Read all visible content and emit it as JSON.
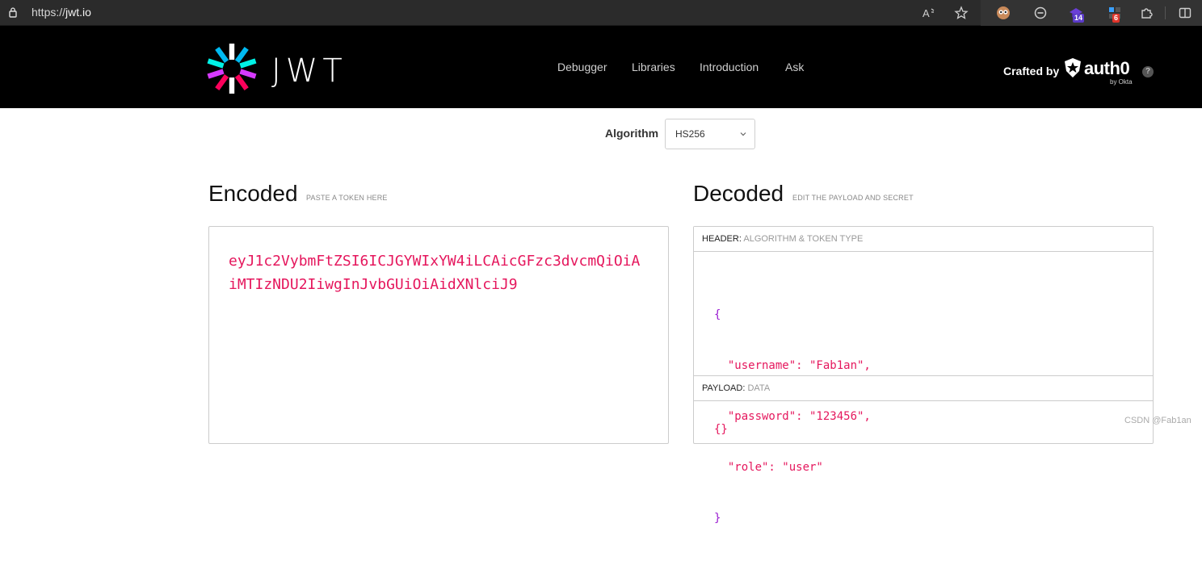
{
  "browser": {
    "url_scheme": "https://",
    "url_host": "jwt.io",
    "badges": {
      "ext1": "14",
      "ext2": "6"
    }
  },
  "header": {
    "wordmark": "JWT",
    "nav": [
      "Debugger",
      "Libraries",
      "Introduction",
      "Ask"
    ],
    "crafted_by": "Crafted by",
    "auth0": "auth0",
    "by_okta": "by Okta",
    "help": "?"
  },
  "algorithm": {
    "label": "Algorithm",
    "value": "HS256"
  },
  "encoded": {
    "title": "Encoded",
    "subtitle": "PASTE A TOKEN HERE",
    "token": "eyJ1c2VybmFtZSI6ICJGYWIxYW4iLCAicGFzc3dvcmQiOiAiMTIzNDU2IiwgInJvbGUiOiAidXNlciJ9"
  },
  "decoded": {
    "title": "Decoded",
    "subtitle": "EDIT THE PAYLOAD AND SECRET",
    "header_label": "HEADER:",
    "header_sub": "ALGORITHM & TOKEN TYPE",
    "header_json": [
      "{",
      "  \"username\": \"Fab1an\",",
      "  \"password\": \"123456\",",
      "  \"role\": \"user\"",
      "}"
    ],
    "payload_label": "PAYLOAD:",
    "payload_sub": "DATA",
    "payload_json": "{}"
  },
  "watermark": "CSDN @Fab1an",
  "colors": {
    "token": "#e5175d",
    "header_bg": "#000000",
    "brace": "#9a1bd1"
  }
}
